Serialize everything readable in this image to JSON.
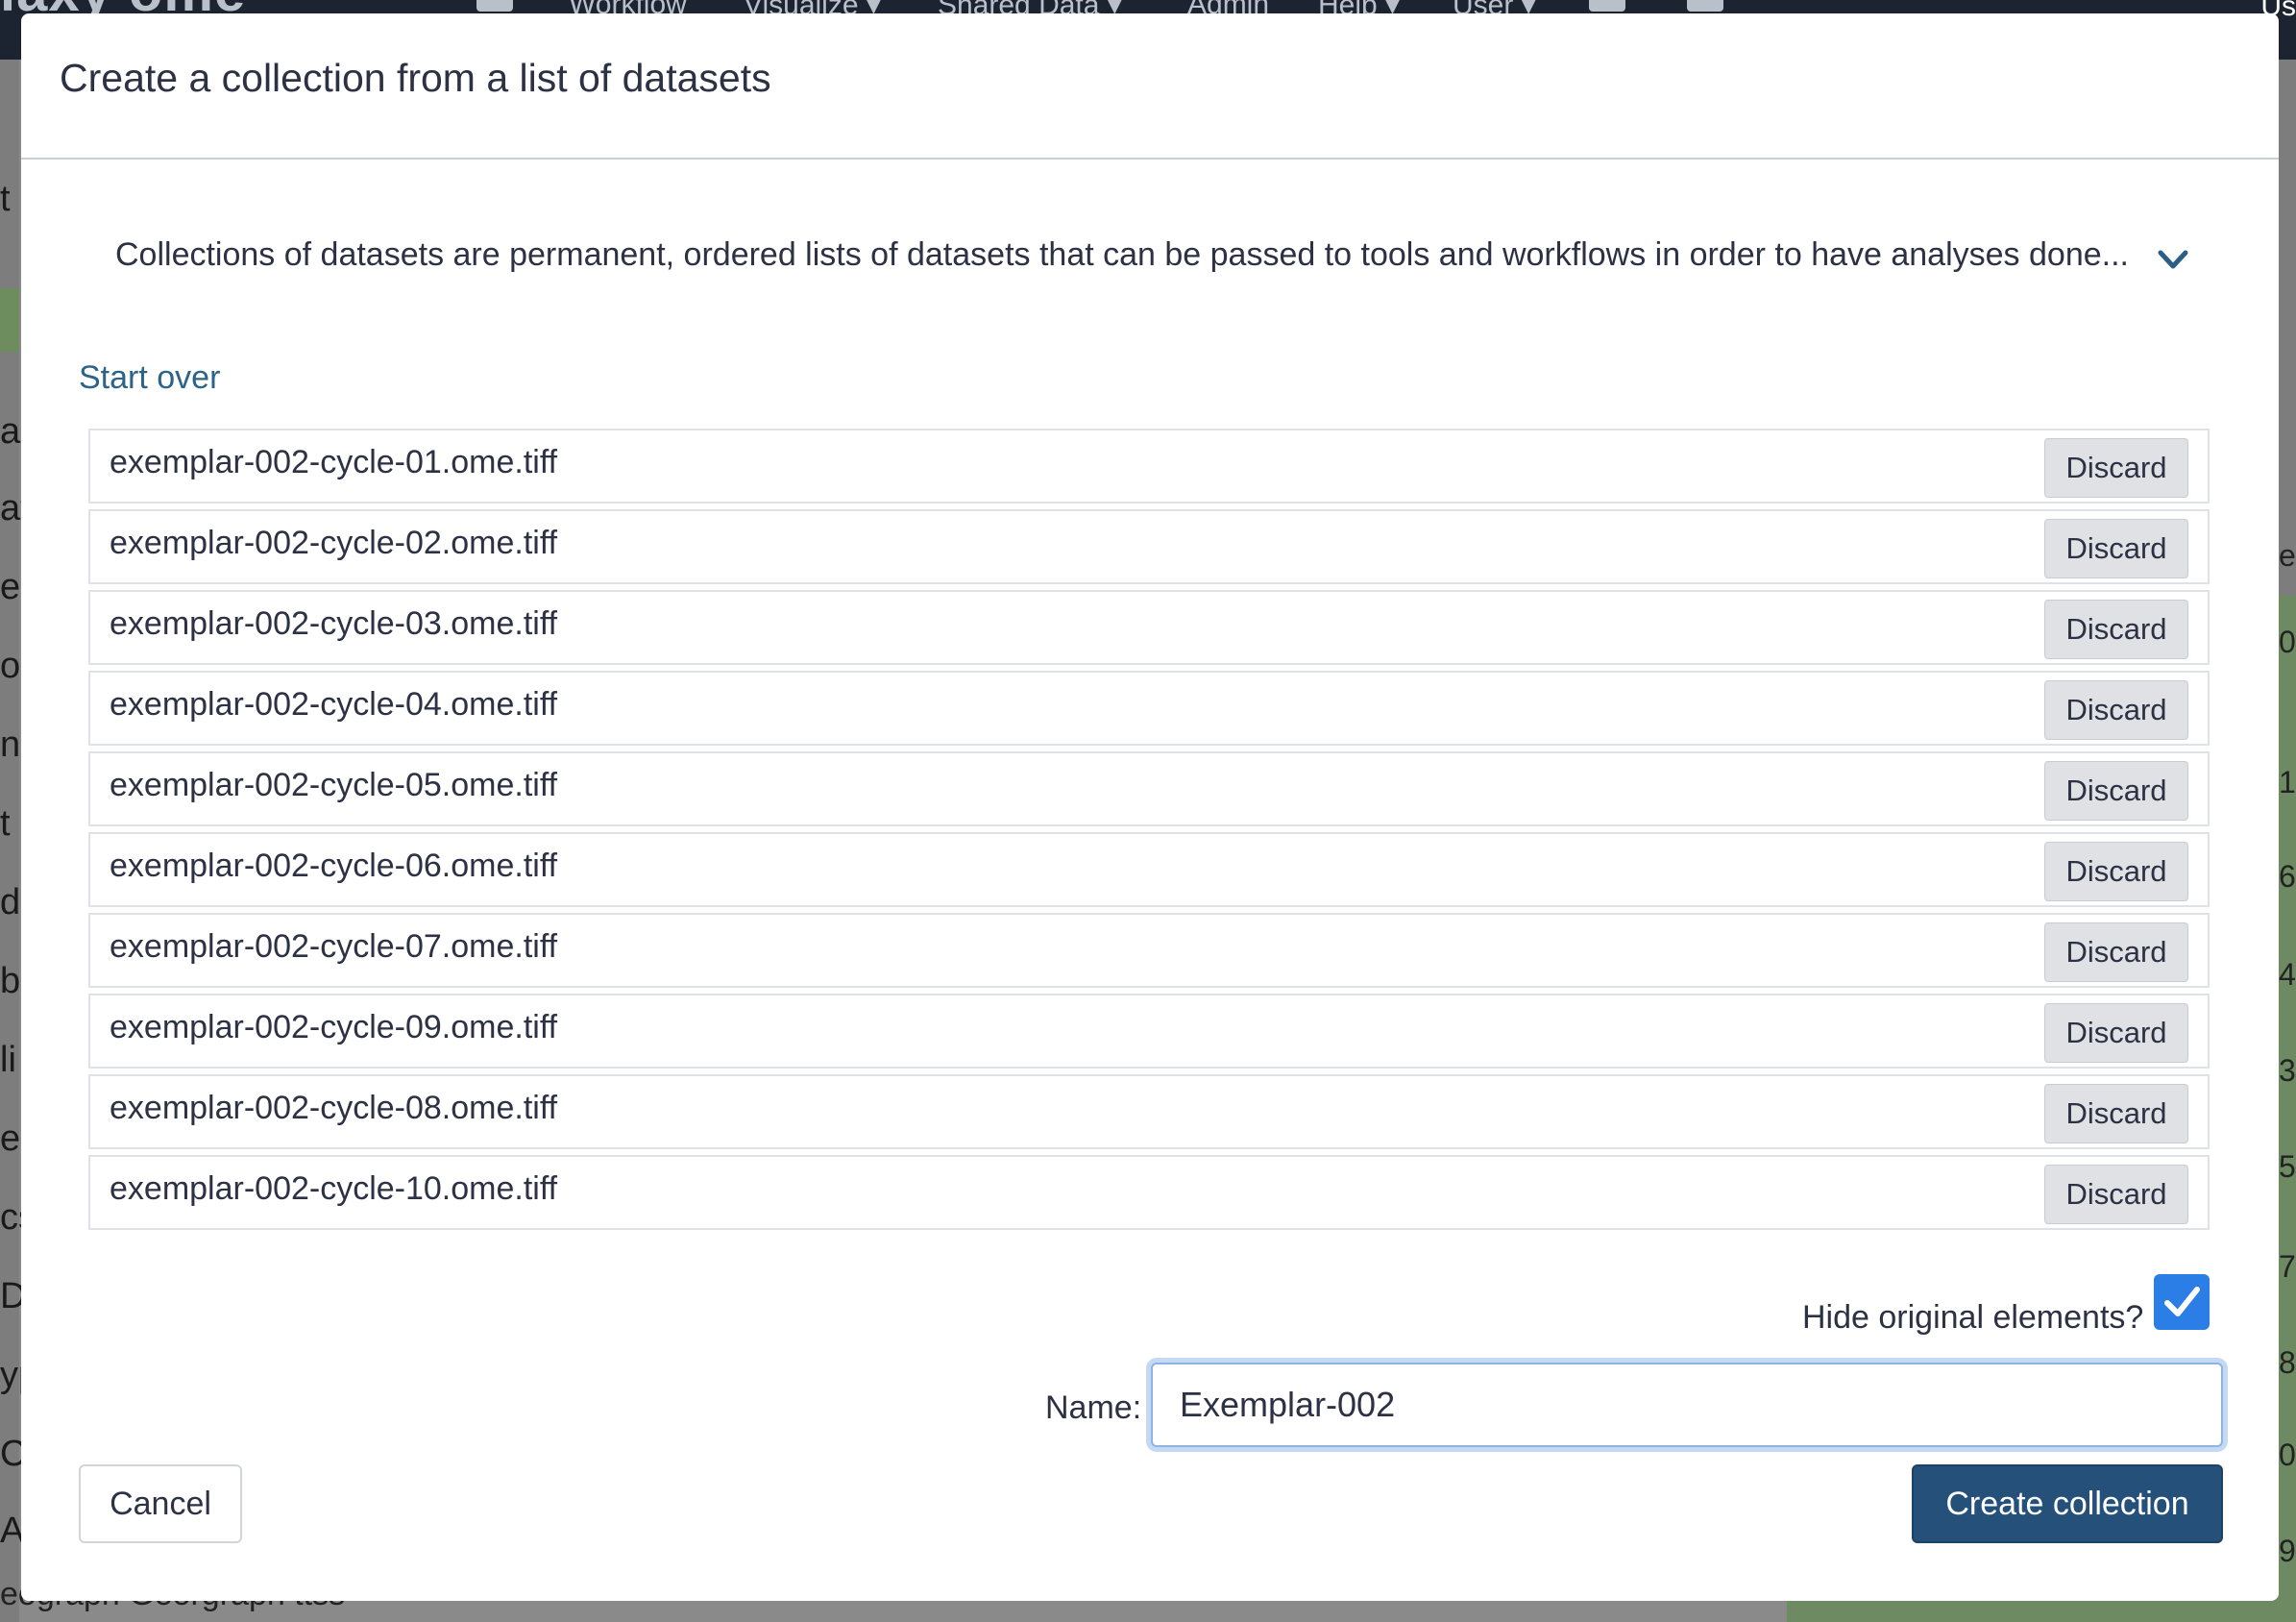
{
  "background": {
    "brand": "laxy ome",
    "nav_items": [
      "Workflow",
      "Visualize ▾",
      "Shared Data ▾",
      "Admin",
      "Help ▾",
      "User ▾"
    ],
    "user_text": "Us",
    "left_panel_letters": [
      "t",
      "a",
      "at",
      "er",
      "o",
      "n",
      "t I",
      "d",
      "b",
      "li",
      "e",
      "cs",
      "Di",
      "yp",
      "C",
      "AT"
    ],
    "right_panel_text": [
      "e",
      "0",
      "1",
      "6",
      "4",
      "3",
      "5",
      "7",
      "8",
      "0",
      "9"
    ],
    "bottom_text": "eograph  Georgraph ttss"
  },
  "modal": {
    "title": "Create a collection from a list of datasets",
    "description": "Collections of datasets are permanent, ordered lists of datasets that can be passed to tools and workflows in order to have analyses done...",
    "expand_icon": "chevron-down-icon",
    "start_over_label": "Start over",
    "discard_label": "Discard",
    "datasets": [
      "exemplar-002-cycle-01.ome.tiff",
      "exemplar-002-cycle-02.ome.tiff",
      "exemplar-002-cycle-03.ome.tiff",
      "exemplar-002-cycle-04.ome.tiff",
      "exemplar-002-cycle-05.ome.tiff",
      "exemplar-002-cycle-06.ome.tiff",
      "exemplar-002-cycle-07.ome.tiff",
      "exemplar-002-cycle-09.ome.tiff",
      "exemplar-002-cycle-08.ome.tiff",
      "exemplar-002-cycle-10.ome.tiff"
    ],
    "hide_original_label": "Hide original elements?",
    "hide_original_checked": true,
    "name_label": "Name:",
    "name_value": "Exemplar-002",
    "cancel_label": "Cancel",
    "create_label": "Create collection"
  },
  "colors": {
    "primary": "#25507a",
    "link": "#2c6389",
    "checkbox": "#2b7ee6",
    "focus_ring": "#c4d9f3"
  }
}
